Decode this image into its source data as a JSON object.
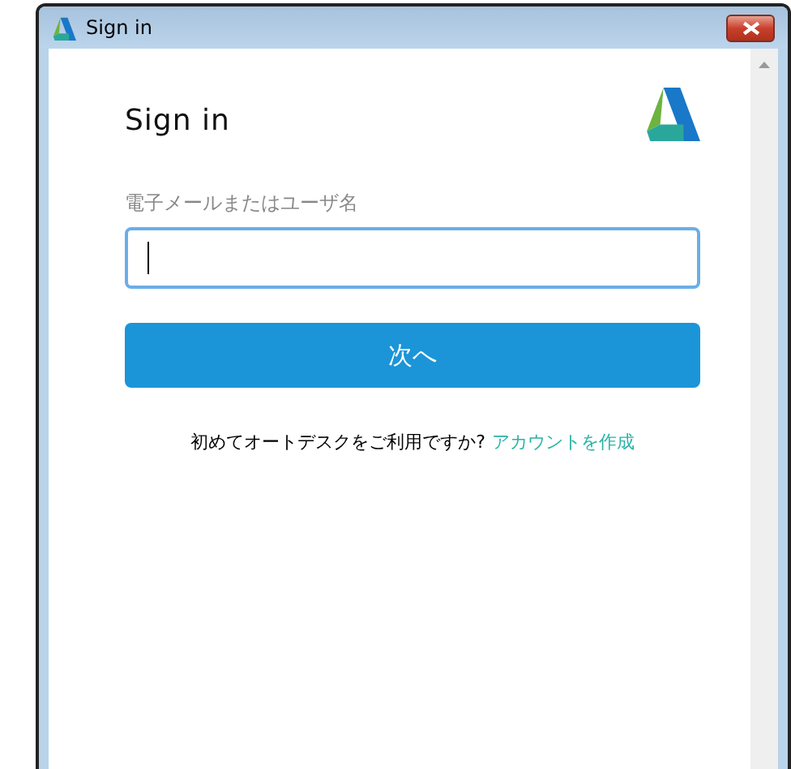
{
  "window": {
    "title": "Sign in"
  },
  "form": {
    "heading": "Sign in",
    "email_label": "電子メールまたはユーザ名",
    "next_button": "次へ",
    "signup_prompt": "初めてオートデスクをご利用ですか?",
    "signup_link": "アカウントを作成"
  }
}
